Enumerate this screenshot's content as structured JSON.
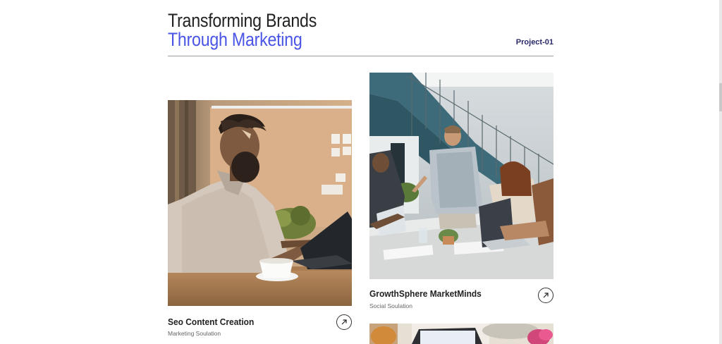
{
  "header": {
    "title_line1": "Transforming Brands",
    "title_line2": "Through Marketing",
    "project_label": "Project-01"
  },
  "cards": [
    {
      "title": "Seo Content Creation",
      "subtitle": "Marketing Soulation",
      "image": "man-working-on-laptop-photo",
      "action_icon": "arrow-up-right-icon"
    },
    {
      "title": "GrowthSphere MarketMinds",
      "subtitle": "Social Soulation",
      "image": "team-meeting-office-photo",
      "action_icon": "arrow-up-right-icon"
    },
    {
      "image": "office-laptop-plant-photo"
    }
  ],
  "colors": {
    "accent": "#4a55e6",
    "heading": "#222222",
    "project_tag": "#2a2a6a",
    "divider": "#9a9a9a"
  }
}
